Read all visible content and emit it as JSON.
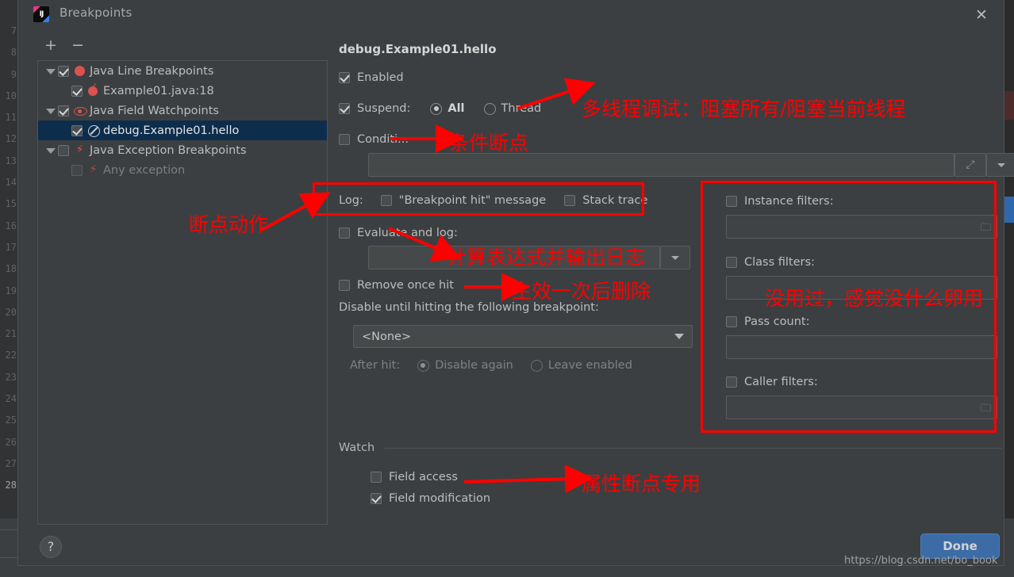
{
  "window": {
    "title": "Breakpoints",
    "icon": "intellij-idea-icon",
    "close_label": "✕"
  },
  "editor_background": {
    "line_numbers": [
      "7",
      "8",
      "9",
      "10",
      "11",
      "12",
      "13",
      "14",
      "15",
      "16",
      "17",
      "18",
      "19",
      "20",
      "21",
      "22",
      "23",
      "24",
      "25",
      "26",
      "27",
      "28"
    ],
    "current_line": "28"
  },
  "toolbar": {
    "add_label": "+",
    "remove_label": "−"
  },
  "tree": {
    "items": [
      {
        "label": "Java Line Breakpoints",
        "icon": "breakpoint-dot-icon",
        "checked": true,
        "expandable": true,
        "indent": 0,
        "selected": false,
        "dim": false
      },
      {
        "label": "Example01.java:18",
        "icon": "breakpoint-hit-icon",
        "checked": true,
        "expandable": false,
        "indent": 1,
        "selected": false,
        "dim": false
      },
      {
        "label": "Java Field Watchpoints",
        "icon": "watchpoint-eye-icon",
        "checked": true,
        "expandable": true,
        "indent": 0,
        "selected": false,
        "dim": false
      },
      {
        "label": "debug.Example01.hello",
        "icon": "disabled-circle-icon",
        "checked": true,
        "expandable": false,
        "indent": 1,
        "selected": true,
        "dim": false
      },
      {
        "label": "Java Exception Breakpoints",
        "icon": "exception-bolt-icon",
        "checked": false,
        "expandable": true,
        "indent": 0,
        "selected": false,
        "dim": false
      },
      {
        "label": "Any exception",
        "icon": "exception-bolt-dim-icon",
        "checked": false,
        "expandable": false,
        "indent": 1,
        "selected": false,
        "dim": true
      }
    ]
  },
  "details": {
    "title": "debug.Example01.hello",
    "enabled": {
      "label": "Enabled",
      "checked": true
    },
    "suspend": {
      "label": "Suspend:",
      "checked": true,
      "options": [
        {
          "label": "All",
          "selected": true
        },
        {
          "label": "Thread",
          "selected": false
        }
      ]
    },
    "condition": {
      "label": "Conditi...",
      "checked": false,
      "value": "",
      "expand_icon": "expand-arrows-icon",
      "dropdown_icon": "chevron-down-icon"
    },
    "log": {
      "label": "Log:",
      "breakpoint_hit_message": {
        "label": "\"Breakpoint hit\" message",
        "checked": false
      },
      "stack_trace": {
        "label": "Stack trace",
        "checked": false
      }
    },
    "evaluate_and_log": {
      "label": "Evaluate and log:",
      "checked": false,
      "value": "",
      "dropdown_icon": "chevron-down-icon"
    },
    "remove_once_hit": {
      "label": "Remove once hit",
      "checked": false
    },
    "disable_until": {
      "label": "Disable until hitting the following breakpoint:",
      "selected_value": "<None>",
      "dropdown_icon": "chevron-down-icon"
    },
    "after_hit": {
      "label": "After hit:",
      "options": [
        {
          "label": "Disable again",
          "selected": true
        },
        {
          "label": "Leave enabled",
          "selected": false
        }
      ]
    },
    "filters": {
      "instance": {
        "label": "Instance filters:",
        "checked": false,
        "value": "",
        "browse_icon": "folder-icon"
      },
      "class": {
        "label": "Class filters:",
        "checked": false,
        "value": "",
        "browse_icon": ""
      },
      "pass_count": {
        "label": "Pass count:",
        "checked": false,
        "value": "",
        "browse_icon": ""
      },
      "caller": {
        "label": "Caller filters:",
        "checked": false,
        "value": "",
        "browse_icon": "folder-icon"
      }
    },
    "watch": {
      "group_label": "Watch",
      "field_access": {
        "label": "Field access",
        "checked": false
      },
      "field_modification": {
        "label": "Field modification",
        "checked": true
      }
    }
  },
  "footer": {
    "help_label": "?",
    "done_label": "Done",
    "watermark": "https://blog.csdn.net/bo_book"
  },
  "annotations": {
    "accent_color": "#ff0000",
    "notes": [
      {
        "id": "multithread",
        "text": "多线程调试：阻塞所有/阻塞当前线程"
      },
      {
        "id": "conditional",
        "text": "条件断点"
      },
      {
        "id": "breakpoint-action",
        "text": "断点动作"
      },
      {
        "id": "evaluate-log",
        "text": "计算表达式并输出日志"
      },
      {
        "id": "remove-once",
        "text": "生效一次后删除"
      },
      {
        "id": "filters-useless",
        "text": "没用过，感觉没什么卵用"
      },
      {
        "id": "field-watch",
        "text": "属性断点专用"
      }
    ]
  }
}
